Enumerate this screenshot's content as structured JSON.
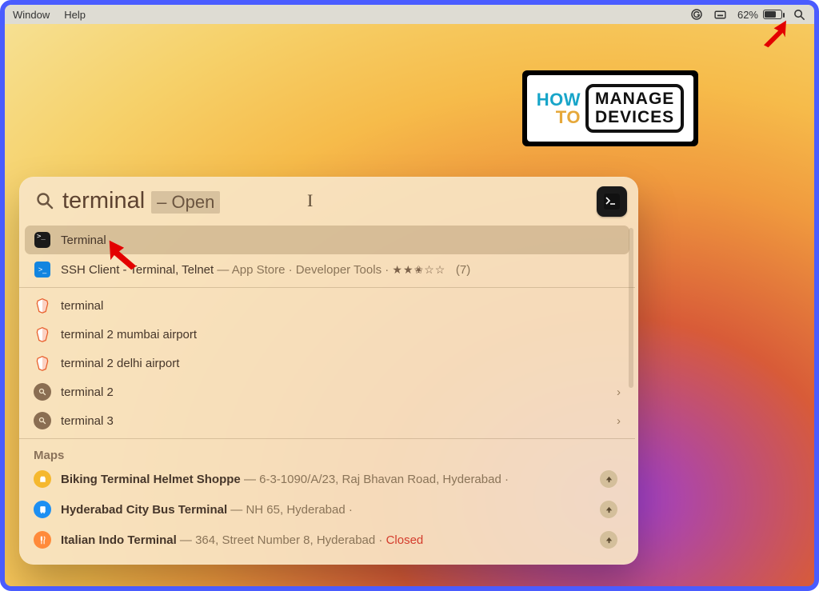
{
  "menubar": {
    "items": [
      "Window",
      "Help"
    ],
    "battery_percent": "62%"
  },
  "watermark": {
    "line1": "HOW",
    "line2": "TO",
    "box_line1": "MANAGE",
    "box_line2": "DEVICES"
  },
  "spotlight": {
    "query": "terminal",
    "completion": "– Open",
    "top_hit": {
      "label": "Terminal"
    },
    "app_store": {
      "title": "SSH Client - Terminal, Telnet",
      "source": "App Store",
      "category": "Developer Tools",
      "rating_count": "(7)"
    },
    "web": [
      {
        "label": "terminal"
      },
      {
        "label": "terminal 2 mumbai airport"
      },
      {
        "label": "terminal 2 delhi airport"
      }
    ],
    "suggestions": [
      {
        "label": "terminal 2"
      },
      {
        "label": "terminal 3"
      }
    ],
    "maps_header": "Maps",
    "maps": [
      {
        "title": "Biking Terminal Helmet Shoppe",
        "address": "6-3-1090/A/23, Raj Bhavan Road, Hyderabad",
        "trailing": "·",
        "closed": ""
      },
      {
        "title": "Hyderabad City Bus Terminal",
        "address": "NH 65, Hyderabad",
        "trailing": "·",
        "closed": ""
      },
      {
        "title": "Italian Indo Terminal",
        "address": "364, Street Number 8, Hyderabad",
        "trailing": "·",
        "closed": "Closed"
      }
    ]
  }
}
